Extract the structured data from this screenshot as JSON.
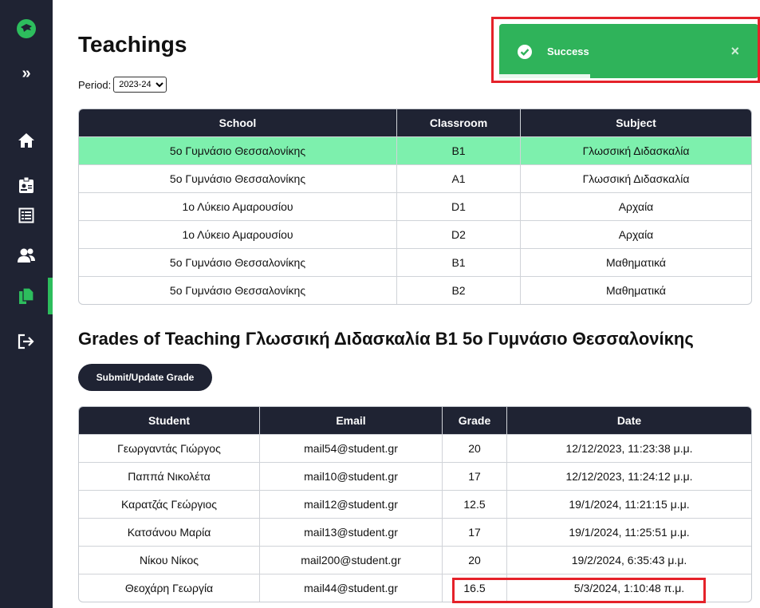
{
  "sidebar": {
    "icons": [
      "logo-icon",
      "expand-icon",
      "home-icon",
      "id-badge-icon",
      "list-icon",
      "users-icon",
      "copy-icon",
      "logout-icon"
    ],
    "expand_glyph": "»",
    "active_color": "#2dbd5d",
    "bg_color": "#1f2333"
  },
  "header": {
    "title": "Teachings",
    "period_label": "Period:",
    "period_selected": "2023-24"
  },
  "teachings_table": {
    "columns": [
      "School",
      "Classroom",
      "Subject"
    ],
    "rows": [
      {
        "school": "5ο Γυμνάσιο Θεσσαλονίκης",
        "classroom": "B1",
        "subject": "Γλωσσική Διδασκαλία"
      },
      {
        "school": "5ο Γυμνάσιο Θεσσαλονίκης",
        "classroom": "A1",
        "subject": "Γλωσσική Διδασκαλία"
      },
      {
        "school": "1ο Λύκειο Αμαρουσίου",
        "classroom": "D1",
        "subject": "Αρχαία"
      },
      {
        "school": "1ο Λύκειο Αμαρουσίου",
        "classroom": "D2",
        "subject": "Αρχαία"
      },
      {
        "school": "5ο Γυμνάσιο Θεσσαλονίκης",
        "classroom": "B1",
        "subject": "Μαθηματικά"
      },
      {
        "school": "5ο Γυμνάσιο Θεσσαλονίκης",
        "classroom": "B2",
        "subject": "Μαθηματικά"
      }
    ]
  },
  "grades": {
    "title": "Grades of Teaching Γλωσσική Διδασκαλία B1 5ο Γυμνάσιο Θεσσαλονίκης",
    "submit_label": "Submit/Update Grade",
    "columns": [
      "Student",
      "Email",
      "Grade",
      "Date"
    ],
    "rows": [
      {
        "student": "Γεωργαντάς Γιώργος",
        "email": "mail54@student.gr",
        "grade": "20",
        "date": "12/12/2023, 11:23:38 μ.μ."
      },
      {
        "student": "Παππά Νικολέτα",
        "email": "mail10@student.gr",
        "grade": "17",
        "date": "12/12/2023, 11:24:12 μ.μ."
      },
      {
        "student": "Καρατζάς Γεώργιος",
        "email": "mail12@student.gr",
        "grade": "12.5",
        "date": "19/1/2024, 11:21:15 μ.μ."
      },
      {
        "student": "Κατσάνου Μαρία",
        "email": "mail13@student.gr",
        "grade": "17",
        "date": "19/1/2024, 11:25:51 μ.μ."
      },
      {
        "student": "Νίκου Νίκος",
        "email": "mail200@student.gr",
        "grade": "20",
        "date": "19/2/2024, 6:35:43 μ.μ."
      },
      {
        "student": "Θεοχάρη Γεωργία",
        "email": "mail44@student.gr",
        "grade": "16.5",
        "date": "5/3/2024, 1:10:48 π.μ."
      }
    ]
  },
  "toast": {
    "message": "Success",
    "close_glyph": "×",
    "color": "#2fb35a",
    "remaining_fraction": 0.35
  },
  "colors": {
    "header_bg": "#1f2333",
    "selected_row": "#7df0ad",
    "highlight": "#e5222a"
  }
}
